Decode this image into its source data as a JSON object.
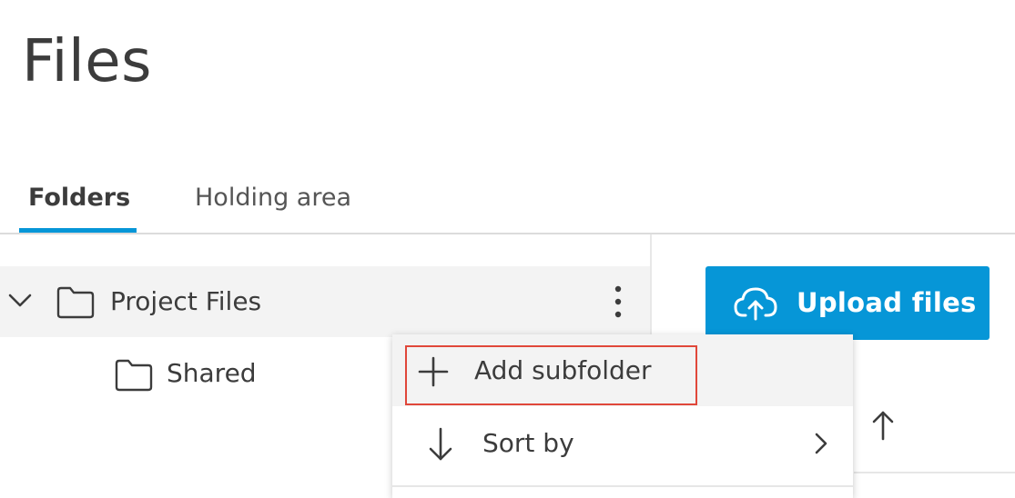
{
  "page": {
    "title": "Files"
  },
  "tabs": [
    {
      "label": "Folders",
      "active": true
    },
    {
      "label": "Holding area",
      "active": false
    }
  ],
  "tree": {
    "root": {
      "label": "Project Files",
      "expanded": true,
      "icon": "folder-icon"
    },
    "children": [
      {
        "label": "Shared",
        "icon": "folder-icon"
      }
    ]
  },
  "toolbar": {
    "upload_label": "Upload files",
    "upload_icon": "cloud-upload-icon",
    "sort_icon": "arrow-up-icon"
  },
  "context_menu": {
    "items": [
      {
        "label": "Add subfolder",
        "icon": "plus-icon",
        "highlighted": true
      },
      {
        "label": "Sort by",
        "icon": "arrow-down-icon",
        "submenu": true
      }
    ]
  },
  "colors": {
    "accent": "#0696d7",
    "highlight_outline": "#e0473a",
    "text": "#3c3c3c",
    "row_hover": "#f3f3f3"
  }
}
